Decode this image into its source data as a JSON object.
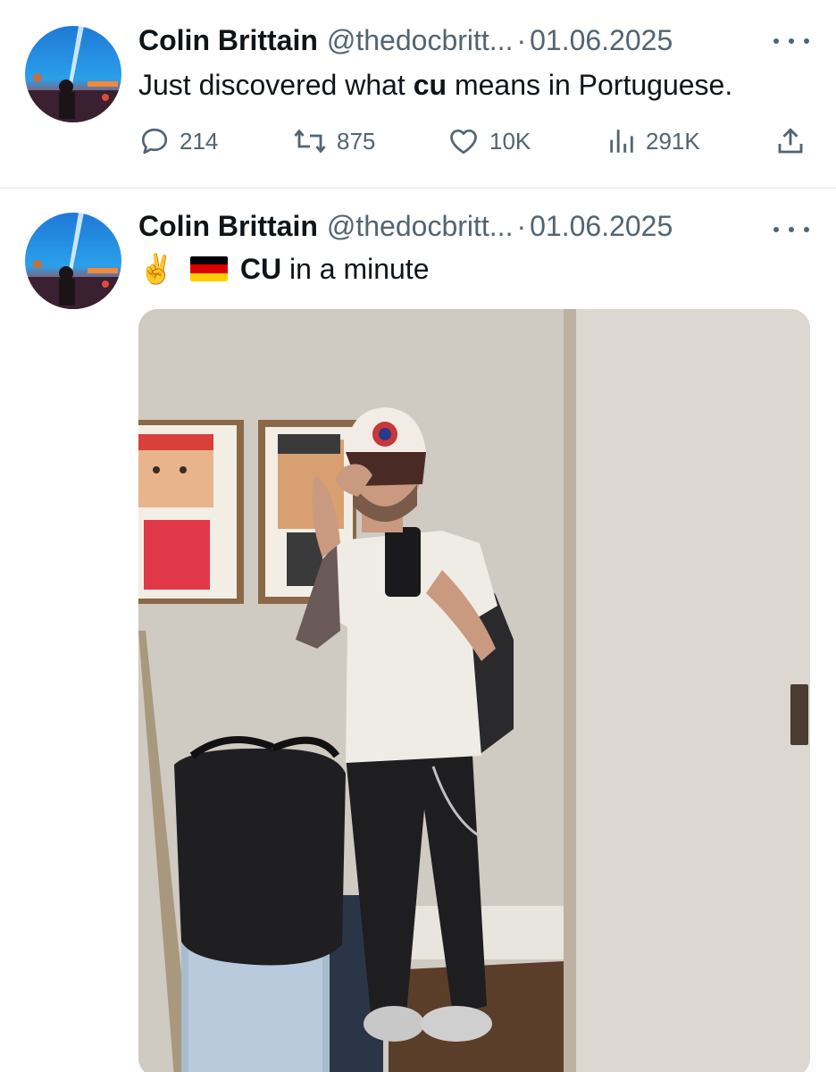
{
  "tweets": [
    {
      "author_name": "Colin Brittain",
      "handle": "@thedocbritt...",
      "separator": "·",
      "date": "01.06.2025",
      "text_before": "Just discovered what ",
      "text_bold": "cu",
      "text_after": " means in Portuguese.",
      "actions": {
        "replies": "214",
        "reposts": "875",
        "likes": "10K",
        "views": "291K"
      }
    },
    {
      "author_name": "Colin Brittain",
      "handle": "@thedocbritt...",
      "separator": "·",
      "date": "01.06.2025",
      "emoji": "✌️",
      "text_bold": "CU",
      "text_after": " in a minute"
    }
  ],
  "icons": {
    "reply": "reply-icon",
    "repost": "repost-icon",
    "like": "like-icon",
    "views": "views-icon",
    "share": "share-icon",
    "more": "more-icon",
    "flag": "germany-flag-icon"
  },
  "colors": {
    "text_primary": "#0f1419",
    "text_secondary": "#536471",
    "divider": "#e6e8ea"
  }
}
